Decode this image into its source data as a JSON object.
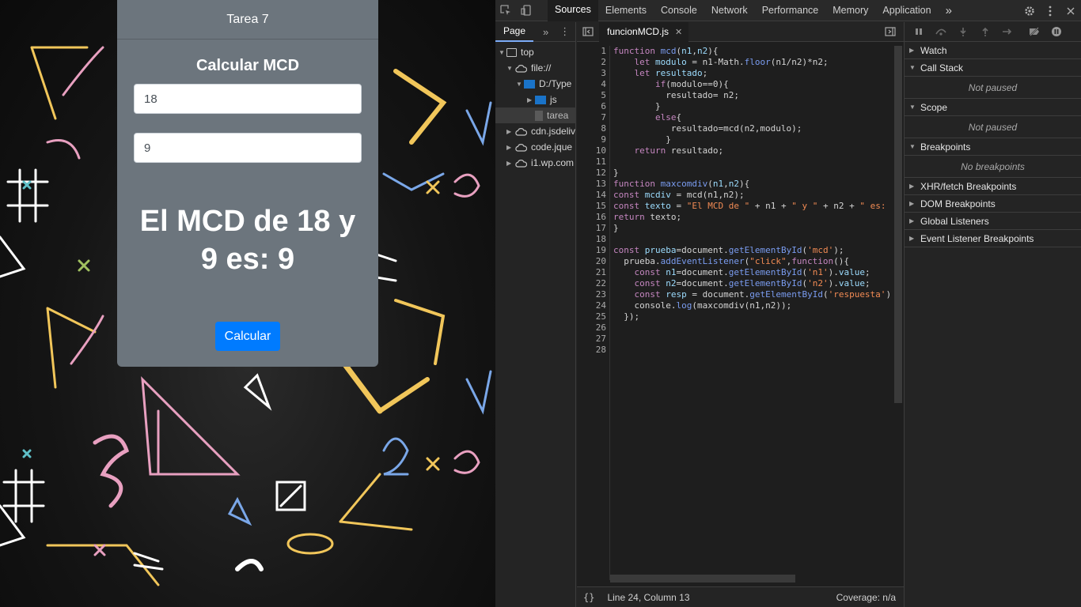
{
  "page": {
    "header": "Tarea 7",
    "title": "Calcular MCD",
    "input1": "18",
    "input2": "9",
    "result_line1": "El MCD de 18 y",
    "result_line2": "9 es: 9",
    "button": "Calcular",
    "card_color": "#6c757d",
    "button_color": "#007bff"
  },
  "devtools": {
    "tabs": [
      "Sources",
      "Elements",
      "Console",
      "Network",
      "Performance",
      "Memory",
      "Application"
    ],
    "more_tabs": "»",
    "navigator_tab": "Page",
    "tree": [
      "top",
      "file://",
      "D:/Type",
      "js",
      "tarea",
      "cdn.jsdeliv",
      "code.jque",
      "i1.wp.com"
    ],
    "file_tab": "funcionMCD.js",
    "line_numbers": [
      "1",
      "2",
      "3",
      "4",
      "5",
      "6",
      "7",
      "8",
      "9",
      "10",
      "11",
      "12",
      "13",
      "14",
      "15",
      "16",
      "17",
      "18",
      "19",
      "20",
      "21",
      "22",
      "23",
      "24",
      "25",
      "26",
      "27",
      "28"
    ],
    "status_position": "Line 24, Column 13",
    "status_coverage": "Coverage: n/a",
    "status_braces": "{}",
    "sections": {
      "watch": "Watch",
      "call_stack": "Call Stack",
      "call_stack_empty": "Not paused",
      "scope": "Scope",
      "scope_empty": "Not paused",
      "breakpoints": "Breakpoints",
      "breakpoints_empty": "No breakpoints",
      "xhr": "XHR/fetch Breakpoints",
      "dom": "DOM Breakpoints",
      "global": "Global Listeners",
      "event": "Event Listener Breakpoints"
    }
  }
}
